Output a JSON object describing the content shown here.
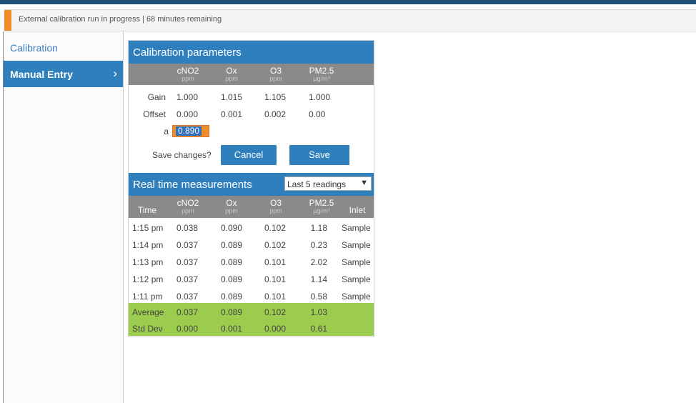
{
  "status": {
    "text": "External calibration run in progress | 68 minutes remaining"
  },
  "sidebar": {
    "items": [
      {
        "label": "Calibration"
      },
      {
        "label": "Manual Entry",
        "chevron": "›"
      }
    ]
  },
  "calibration": {
    "title": "Calibration parameters",
    "columns": [
      {
        "name": "cNO2",
        "unit": "ppm"
      },
      {
        "name": "Ox",
        "unit": "ppm"
      },
      {
        "name": "O3",
        "unit": "ppm"
      },
      {
        "name": "PM2.5",
        "unit": "µg/m³"
      }
    ],
    "rows": [
      {
        "label": "Gain",
        "values": [
          "1.000",
          "1.015",
          "1.105",
          "1.000"
        ]
      },
      {
        "label": "Offset",
        "values": [
          "0.000",
          "0.001",
          "0.002",
          "0.00"
        ]
      }
    ],
    "a_label": "a",
    "a_value": "0.890",
    "save_prompt": "Save changes?",
    "cancel_label": "Cancel",
    "save_label": "Save"
  },
  "realtime": {
    "title": "Real time measurements",
    "dropdown_value": "Last 5 readings",
    "dropdown_arrow": "▼",
    "time_header": "Time",
    "inlet_header": "Inlet",
    "rows": [
      {
        "time": "1:15 pm",
        "values": [
          "0.038",
          "0.090",
          "0.102",
          "1.18"
        ],
        "inlet": "Sample"
      },
      {
        "time": "1:14 pm",
        "values": [
          "0.037",
          "0.089",
          "0.102",
          "0.23"
        ],
        "inlet": "Sample"
      },
      {
        "time": "1:13 pm",
        "values": [
          "0.037",
          "0.089",
          "0.101",
          "2.02"
        ],
        "inlet": "Sample"
      },
      {
        "time": "1:12 pm",
        "values": [
          "0.037",
          "0.089",
          "0.101",
          "1.14"
        ],
        "inlet": "Sample"
      },
      {
        "time": "1:11 pm",
        "values": [
          "0.037",
          "0.089",
          "0.101",
          "0.58"
        ],
        "inlet": "Sample"
      }
    ],
    "summary": [
      {
        "label": "Average",
        "values": [
          "0.037",
          "0.089",
          "0.102",
          "1.03"
        ]
      },
      {
        "label": "Std Dev",
        "values": [
          "0.000",
          "0.001",
          "0.000",
          "0.61"
        ]
      }
    ]
  },
  "colors": {
    "accent_blue": "#2f7fbd",
    "status_orange": "#f08c2a",
    "summary_green": "#9bcc4e",
    "header_gray": "#8a8a8a"
  }
}
